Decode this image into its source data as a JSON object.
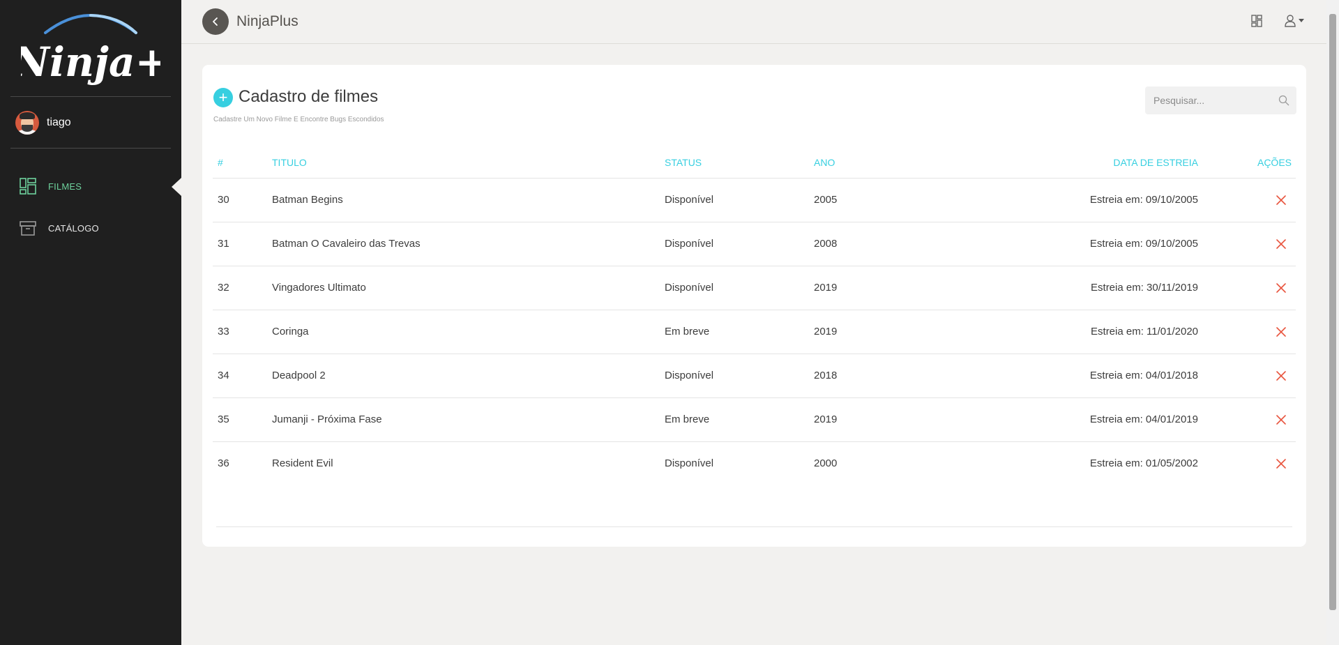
{
  "sidebar": {
    "logo_text": "Ninja+",
    "user": {
      "name": "tiago"
    },
    "nav": [
      {
        "label": "FILMES",
        "icon": "dashboard-grid-icon",
        "active": true
      },
      {
        "label": "CATÁLOGO",
        "icon": "archive-box-icon",
        "active": false
      }
    ]
  },
  "header": {
    "title": "NinjaPlus",
    "icons": [
      "back-arrow-icon",
      "layout-grid-icon",
      "user-icon",
      "caret-down-icon"
    ]
  },
  "page": {
    "title": "Cadastro de filmes",
    "subtitle": "Cadastre Um Novo Filme E Encontre Bugs Escondidos",
    "search_placeholder": "Pesquisar..."
  },
  "table": {
    "headers": {
      "id": "#",
      "title": "TITULO",
      "status": "STATUS",
      "year": "ANO",
      "date": "DATA DE ESTREIA",
      "actions": "AÇÕES"
    },
    "rows": [
      {
        "id": "30",
        "title": "Batman Begins",
        "status": "Disponível",
        "year": "2005",
        "date": "Estreia em: 09/10/2005"
      },
      {
        "id": "31",
        "title": "Batman O Cavaleiro das Trevas",
        "status": "Disponível",
        "year": "2008",
        "date": "Estreia em: 09/10/2005"
      },
      {
        "id": "32",
        "title": "Vingadores Ultimato",
        "status": "Disponível",
        "year": "2019",
        "date": "Estreia em: 30/11/2019"
      },
      {
        "id": "33",
        "title": "Coringa",
        "status": "Em breve",
        "year": "2019",
        "date": "Estreia em: 11/01/2020"
      },
      {
        "id": "34",
        "title": "Deadpool 2",
        "status": "Disponível",
        "year": "2018",
        "date": "Estreia em: 04/01/2018"
      },
      {
        "id": "35",
        "title": "Jumanji - Próxima Fase",
        "status": "Em breve",
        "year": "2019",
        "date": "Estreia em: 04/01/2019"
      },
      {
        "id": "36",
        "title": "Resident Evil",
        "status": "Disponível",
        "year": "2000",
        "date": "Estreia em: 01/05/2002"
      }
    ]
  },
  "colors": {
    "sidebar_bg": "#1f1f1f",
    "accent_cyan": "#37cfe0",
    "active_nav_green": "#6ed29d",
    "delete_red": "#e8553f",
    "page_bg": "#f2f1ef"
  }
}
